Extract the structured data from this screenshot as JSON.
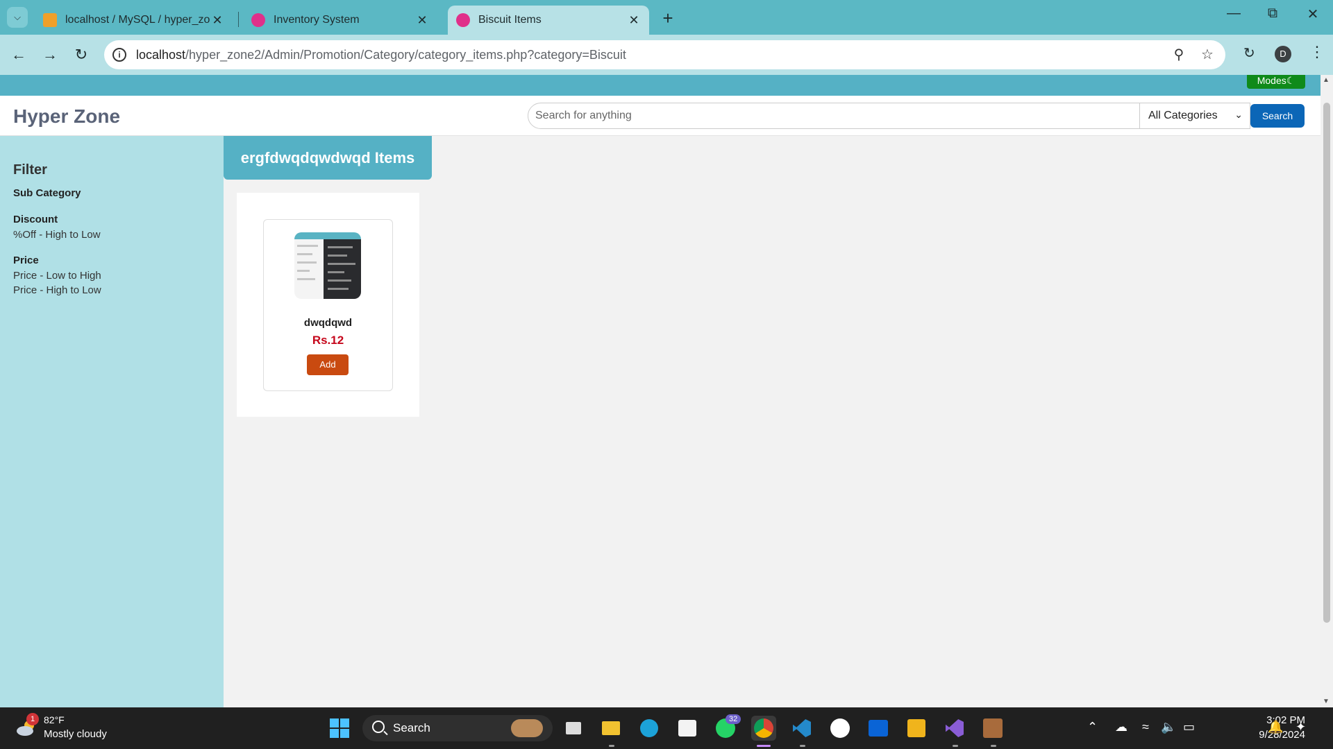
{
  "browser": {
    "tabs": [
      {
        "title": "localhost / MySQL / hyper_zone",
        "icon": "phpmyadmin-icon",
        "active": false
      },
      {
        "title": "Inventory System",
        "icon": "wamp-icon",
        "active": false
      },
      {
        "title": "Biscuit Items",
        "icon": "wamp-icon",
        "active": true
      }
    ],
    "url_host": "localhost",
    "url_path": "/hyper_zone2/Admin/Promotion/Category/category_items.php?category=Biscuit",
    "profile_initial": "D"
  },
  "page": {
    "modes_label": "Modes☾",
    "brand": "Hyper Zone",
    "search": {
      "placeholder": "Search for anything",
      "category_selected": "All Categories",
      "button_label": "Search"
    },
    "sidebar": {
      "title": "Filter",
      "sub_category_label": "Sub Category",
      "discount_label": "Discount",
      "discount_options": [
        "%Off - High to Low"
      ],
      "price_label": "Price",
      "price_options": [
        "Price - Low to High",
        "Price - High to Low"
      ]
    },
    "category_heading": "ergfdwqdqwdwqd Items",
    "products": [
      {
        "name": "dwqdqwd",
        "price": "Rs.12",
        "add_label": "Add"
      }
    ]
  },
  "taskbar": {
    "weather_badge": "1",
    "weather_temp": "82°F",
    "weather_desc": "Mostly cloudy",
    "search_label": "Search",
    "whatsapp_badge": "32",
    "time": "3:02 PM",
    "date": "9/28/2024"
  },
  "colors": {
    "tabstrip": "#5bb8c4",
    "toolbar": "#b7e1e6",
    "brand_accent": "#55b1c5",
    "sidebar": "#b0e0e6",
    "search_button": "#0b66b7",
    "price": "#c5061b",
    "add_button": "#c94a10",
    "modes_button": "#0f8a1a"
  }
}
